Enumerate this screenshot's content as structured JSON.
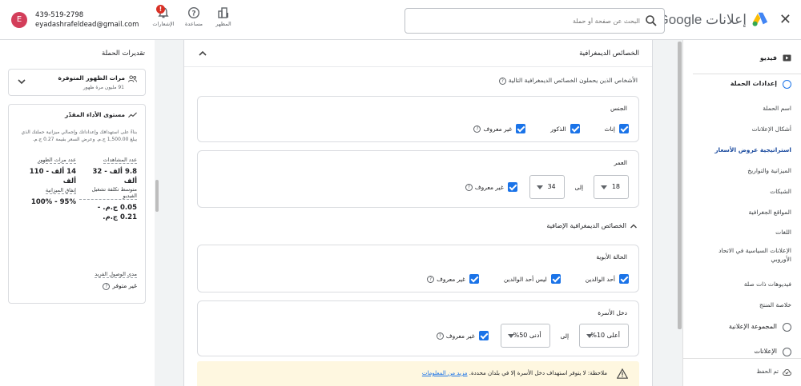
{
  "header": {
    "brand_google": "Google",
    "brand_ads": "إعلانات",
    "search_placeholder": "البحث عن صفحة أو حملة",
    "tools": {
      "appearance": "المظهر",
      "help": "مساعدة",
      "notifications": "الإشعارات"
    },
    "notify_badge": "!",
    "account": {
      "initial": "E",
      "phone": "439-519-2798",
      "email": "eyadashrafeldead@gmail.com"
    }
  },
  "nav": {
    "video": "فيديو",
    "campaign_settings": "إعدادات الحملة",
    "sub_items": [
      {
        "label": "اسم الحملة",
        "active": false
      },
      {
        "label": "أشكال الإعلانات",
        "active": false
      },
      {
        "label": "استراتيجية عروض الأسعار",
        "active": true
      },
      {
        "label": "الميزانية والتواريخ",
        "active": false
      },
      {
        "label": "الشبكات",
        "active": false
      },
      {
        "label": "المواقع الجغرافية",
        "active": false
      },
      {
        "label": "اللغات",
        "active": false
      },
      {
        "label": "الإعلانات السياسية في الاتحاد الأوروبي",
        "active": false
      },
      {
        "label": "فيديوهات ذات صلة",
        "active": false
      },
      {
        "label": "خلاصة المنتج",
        "active": false
      }
    ],
    "ad_group": "المجموعة الإعلانية",
    "ads": "الإعلانات",
    "footer_save": "تم الحفظ"
  },
  "main": {
    "panel_title": "الخصائص الديمغرافية",
    "panel_desc": "الأشخاص الذين يحملون الخصائص الديمغرافية التالية",
    "gender": {
      "title": "الجنس",
      "options": [
        "إناث",
        "الذكور",
        "غير معروف"
      ]
    },
    "age": {
      "title": "العمر",
      "from": "18",
      "to_label": "إلى",
      "to": "34",
      "unknown": "غير معروف"
    },
    "extra_title": "الخصائص الديمغرافية الإضافية",
    "parental": {
      "title": "الحالة الأبوية",
      "options": [
        "أحد الوالدين",
        "ليس أحد الوالدين",
        "غير معروف"
      ]
    },
    "income": {
      "title": "دخل الأسرة",
      "from": "أعلى 10%",
      "to_label": "إلى",
      "to": "أدنى 50%",
      "unknown": "غير معروف"
    },
    "notice_text": "ملاحظة: لا يتوفر استهداف دخل الأسرة إلا في بلدان محددة.",
    "notice_link": "مزيد من المعلومات"
  },
  "sidebar": {
    "title": "تقديرات الحملة",
    "reach": {
      "title": "مرات الظهور المتوفرة",
      "subtitle": "91 مليون مرة ظهور"
    },
    "performance": {
      "title": "مستوى الأداء المقدّر",
      "description": "بناءً على استهدافك وإعداداتك وإجمالي ميزانية حملتك الذي يبلغ 1,500.00 ج.م. وعرض السعر بقيمة 0.27 ج.م.",
      "metrics": [
        {
          "label": "عدد مرات الظهور",
          "value": "14 ألف - 110 ألف"
        },
        {
          "label": "عدد المشاهدات",
          "value": "9.8 ألف - 32 ألف"
        },
        {
          "label": "إنفاق الميزانية",
          "value": "95% - 100%"
        },
        {
          "label": "متوسط تكلفة تشغيل الفيديو",
          "value": "0.05 ج.م. - 0.21 ج.م."
        }
      ],
      "reach_label": "مدى الوصول الفريد",
      "reach_value": "غير متوفر"
    }
  }
}
